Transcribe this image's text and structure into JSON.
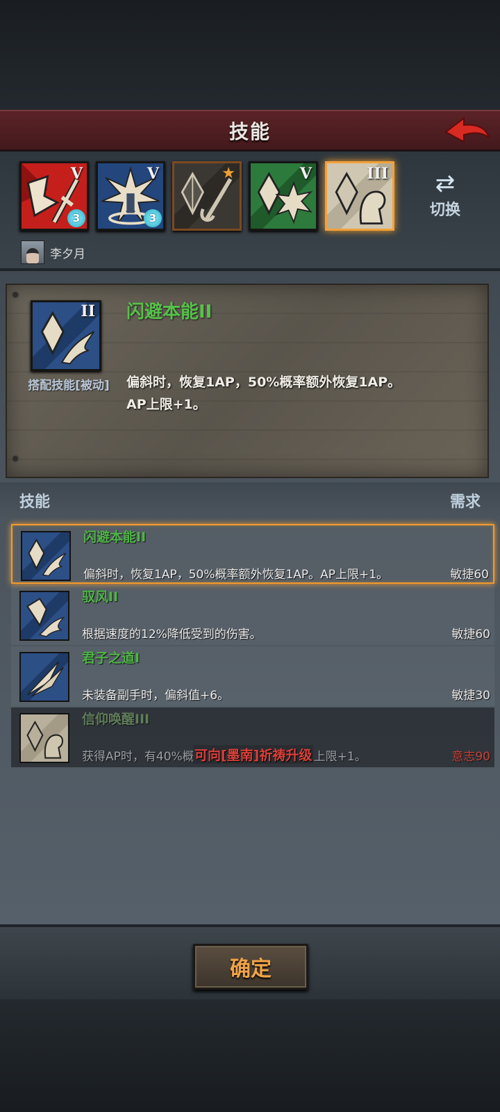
{
  "header": {
    "title": "技能"
  },
  "slots": [
    {
      "rank": "V",
      "gem": "3",
      "icon": "sword-fist-red-icon"
    },
    {
      "rank": "V",
      "gem": "3",
      "icon": "burst-figure-blue-icon"
    },
    {
      "rank": "",
      "gem": "",
      "icon": "gem-spear-icon",
      "starred": true
    },
    {
      "rank": "V",
      "gem": "",
      "icon": "gem-explosion-green-icon"
    },
    {
      "rank": "III",
      "gem": "",
      "icon": "gem-faith-icon",
      "selected": true
    }
  ],
  "switch": {
    "label": "切换",
    "icon": "swap-arrows-icon"
  },
  "character": {
    "name": "李夕月"
  },
  "detail": {
    "rank": "II",
    "name": "闪避本能II",
    "type": "搭配技能[被动]",
    "desc_line1": "偏斜时，恢复1AP，50%概率额外恢复1AP。",
    "desc_line2": "AP上限+1。"
  },
  "list": {
    "header_left": "技能",
    "header_right": "需求",
    "items": [
      {
        "name": "闪避本能II",
        "desc": "偏斜时，恢复1AP，50%概率额外恢复1AP。AP上限+1。",
        "req": "敏捷60",
        "selected": true
      },
      {
        "name": "驭风II",
        "desc": "根据速度的12%降低受到的伤害。",
        "req": "敏捷60"
      },
      {
        "name": "君子之道I",
        "desc": "未装备副手时，偏斜值+6。",
        "req": "敏捷30"
      },
      {
        "name": "信仰唤醒III",
        "desc": "获得AP时，有40%概",
        "desc_tail": "上限+1。",
        "req": "意志90",
        "locked": true,
        "lock_msg": "可向[墨南]祈祷升级"
      }
    ]
  },
  "footer": {
    "confirm_label": "确定"
  },
  "colors": {
    "accent": "#f29a2a",
    "skill_name": "#4fb447",
    "locked": "#d9403a",
    "title_bar": "#5b2327"
  }
}
